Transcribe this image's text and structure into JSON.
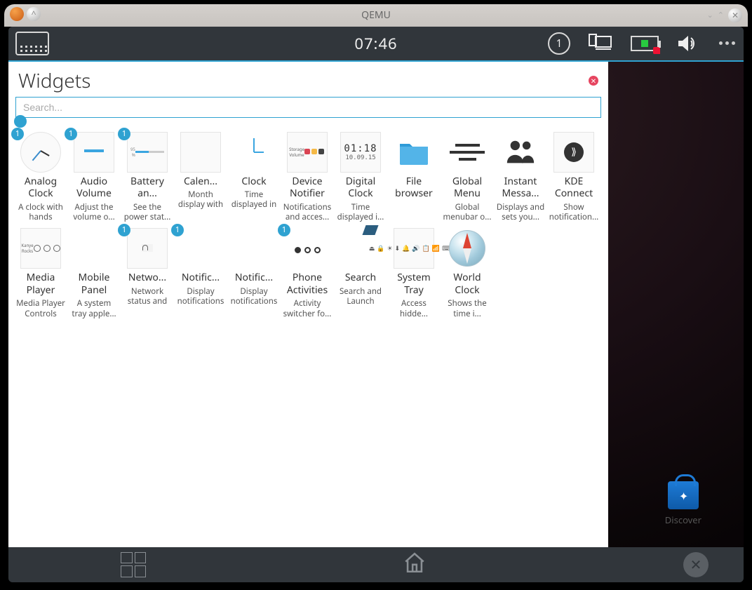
{
  "window": {
    "title": "QEMU"
  },
  "statusbar": {
    "time": "07:46",
    "notif_count": "1"
  },
  "panel": {
    "title": "Widgets",
    "search_placeholder": "Search..."
  },
  "desktop": {
    "discover_label": "Discover"
  },
  "digital_clock_preview": {
    "time": "01:18",
    "date": "10.09.15"
  },
  "widgets": [
    {
      "id": "analog-clock",
      "name": "Analog Clock",
      "desc": "A clock with hands",
      "badge": "1",
      "thumb": "analog"
    },
    {
      "id": "audio-volume",
      "name": "Audio Volume",
      "desc": "Adjust the volume o...",
      "badge": "1",
      "thumb": "lines"
    },
    {
      "id": "battery",
      "name": "Battery an...",
      "desc": "See the power stat...",
      "badge": "1",
      "thumb": "battery"
    },
    {
      "id": "calendar",
      "name": "Calen...",
      "desc": "Month display with you...",
      "badge": "",
      "thumb": "calendar"
    },
    {
      "id": "clock",
      "name": "Clock",
      "desc": "Time displayed in a digita...",
      "badge": "",
      "thumb": "clock"
    },
    {
      "id": "device-notifier",
      "name": "Device Notifier",
      "desc": "Notifications and acces...",
      "badge": "",
      "thumb": "devnotif"
    },
    {
      "id": "digital-clock",
      "name": "Digital Clock",
      "desc": "Time displayed i...",
      "badge": "",
      "thumb": "digital"
    },
    {
      "id": "file-browser",
      "name": "File browser",
      "desc": "",
      "badge": "",
      "thumb": "folder"
    },
    {
      "id": "global-menu",
      "name": "Global Menu",
      "desc": "Global menubar o...",
      "badge": "",
      "thumb": "glmenu"
    },
    {
      "id": "instant-msg",
      "name": "Instant Messa...",
      "desc": "Displays and sets you...",
      "badge": "",
      "thumb": "people"
    },
    {
      "id": "kde-connect",
      "name": "KDE Connect",
      "desc": "Show notification...",
      "badge": "",
      "thumb": "kde"
    },
    {
      "id": "media-player",
      "name": "Media Player",
      "desc": "Media Player Controls",
      "badge": "",
      "thumb": "media"
    },
    {
      "id": "mobile-panel",
      "name": "Mobile Panel",
      "desc": "A system tray apple...",
      "badge": "",
      "thumb": "exclaim"
    },
    {
      "id": "networks",
      "name": "Netwo...",
      "desc": "Network status and control",
      "badge": "1",
      "thumb": "network"
    },
    {
      "id": "notific1",
      "name": "Notific...",
      "desc": "Display notifications and jobs",
      "badge": "1",
      "thumb": "exclaim"
    },
    {
      "id": "notific2",
      "name": "Notific...",
      "desc": "Display notifications and jobs",
      "badge": "",
      "thumb": "exclaim"
    },
    {
      "id": "phone-act",
      "name": "Phone Activities",
      "desc": "Activity switcher fo...",
      "badge": "1",
      "thumb": "dots3"
    },
    {
      "id": "search",
      "name": "Search",
      "desc": "Search and Launch",
      "badge": "",
      "thumb": "search"
    },
    {
      "id": "system-tray",
      "name": "System Tray",
      "desc": "Access hidde...",
      "badge": "",
      "thumb": "tray"
    },
    {
      "id": "world-clock",
      "name": "World Clock",
      "desc": "Shows the time i...",
      "badge": "",
      "thumb": "world"
    }
  ]
}
